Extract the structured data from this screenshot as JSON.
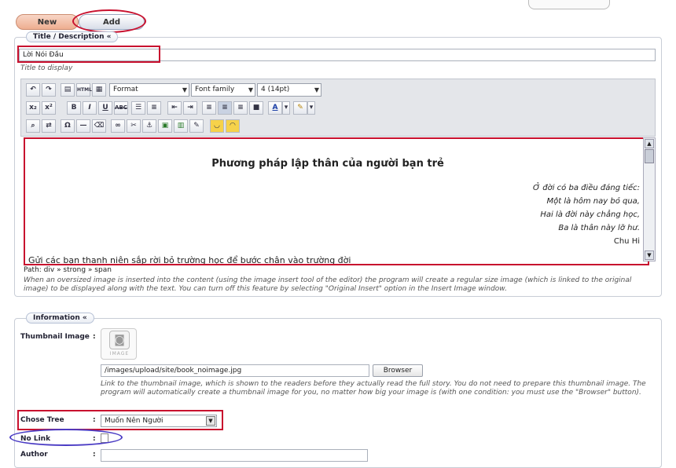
{
  "tabs": {
    "new": "New",
    "add": "Add"
  },
  "title_section": {
    "legend": "Title / Description «",
    "title_value": "Lời Nói Đầu",
    "title_hint": "Title to display"
  },
  "toolbar": {
    "format_label": "Format",
    "font_family_label": "Font family",
    "font_size_label": "4 (14pt)"
  },
  "editor": {
    "heading": "Phương pháp lập thân của người bạn trẻ",
    "poem": [
      "Ở đời có ba điều đáng tiếc:",
      "Một là hôm nay bỏ qua,",
      "Hai là đời này chẳng học,",
      "Ba là thân này lỡ hư."
    ],
    "poem_author": "Chu Hi",
    "cut_line": "Gửi các bạn thanh niên sắp rời bỏ trường học để bước chân vào trường đời",
    "path": "Path: div » strong » span",
    "note": "When an oversized image is inserted into the content (using the image insert tool of the editor) the program will create a regular size image (which is linked to the original image) to be displayed along with the text. You can turn off this feature by selecting \"Original Insert\" option in the Insert Image window."
  },
  "information": {
    "legend": "Information «",
    "thumbnail_label": "Thumbnail Image",
    "thumbnail_placeholder": "IMAGE",
    "thumbnail_path": "/images/upload/site/book_noimage.jpg",
    "browser_button": "Browser",
    "thumbnail_hint": "Link to the thumbnail image, which is shown to the readers before they actually read the full story. You do not need to prepare this thumbnail image. The program will automatically create a thumbnail image for you, no matter how big your image is (with one condition: you must use the \"Browser\" button).",
    "chose_tree_label": "Chose Tree",
    "chose_tree_value": "Muốn Nên Người",
    "no_link_label": "No Link",
    "author_label": "Author",
    "colon": ":"
  }
}
